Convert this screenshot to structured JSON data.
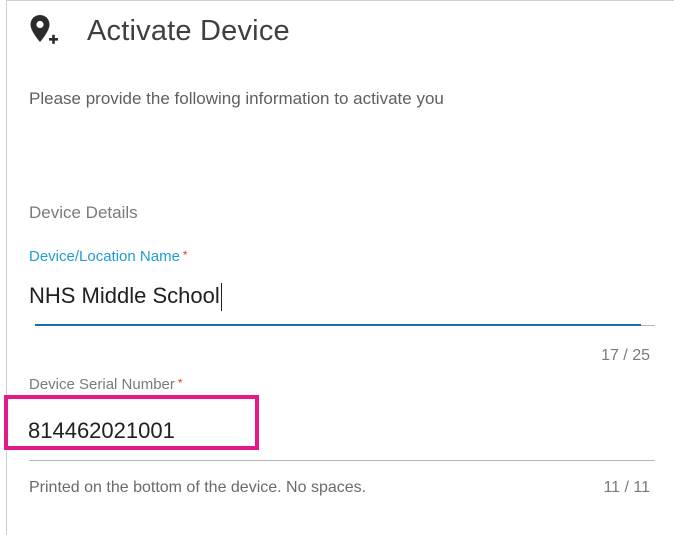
{
  "header": {
    "icon": "add-location-icon",
    "title": "Activate Device"
  },
  "instructions": "Please provide the following information to activate you",
  "section": {
    "title": "Device Details"
  },
  "fields": {
    "name": {
      "label": "Device/Location Name",
      "required_marker": "*",
      "value": "NHS Middle School",
      "counter": "17 / 25"
    },
    "serial": {
      "label": "Device Serial Number",
      "required_marker": "*",
      "value": "814462021001",
      "hint": "Printed on the bottom of the device. No spaces.",
      "counter": "11 / 11"
    }
  },
  "colors": {
    "label_focused": "#1e9bd7",
    "underline_focused": "#1b6fa8",
    "required": "#e53935",
    "highlight": "#e6198a"
  }
}
